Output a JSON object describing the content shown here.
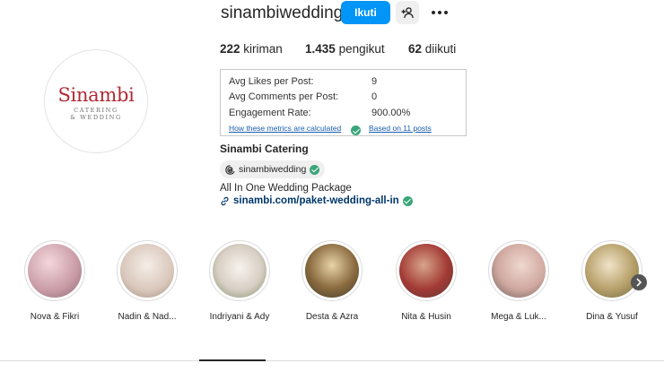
{
  "profile": {
    "username": "sinambiwedding",
    "follow_label": "Ikuti",
    "avatar_logo": {
      "name": "Sinambi",
      "line1": "CATERING",
      "line2": "& WEDDING"
    },
    "stats": {
      "posts_count": "222",
      "posts_label": "kiriman",
      "followers_count": "1.435",
      "followers_label": "pengikut",
      "following_count": "62",
      "following_label": "diikuti"
    },
    "full_name": "Sinambi Catering",
    "threads_handle": "sinambiwedding",
    "bio": "All In One Wedding Package",
    "link_text": "sinambi.com/paket-wedding-all-in"
  },
  "metrics": {
    "rows": [
      {
        "label": "Avg Likes per Post:",
        "value": "9"
      },
      {
        "label": "Avg Comments per Post:",
        "value": "0"
      },
      {
        "label": "Engagement Rate:",
        "value": "900.00%"
      }
    ],
    "how_link": "How these metrics are calculated",
    "based_link": "Based on 11 posts"
  },
  "highlights": [
    {
      "label": "Nova & Fikri"
    },
    {
      "label": "Nadin & Nad..."
    },
    {
      "label": "Indriyani & Ady"
    },
    {
      "label": "Desta & Azra"
    },
    {
      "label": "Nita & Husin"
    },
    {
      "label": "Mega & Luk..."
    },
    {
      "label": "Dina & Yusuf"
    }
  ],
  "colors": {
    "accent": "#0095f6",
    "verified": "#3aa57a",
    "logo_red": "#b22a35",
    "link": "#00376b"
  },
  "icons": [
    "add-person-icon",
    "more-dots-icon",
    "threads-icon",
    "link-icon",
    "check-icon",
    "chevron-right-icon"
  ]
}
